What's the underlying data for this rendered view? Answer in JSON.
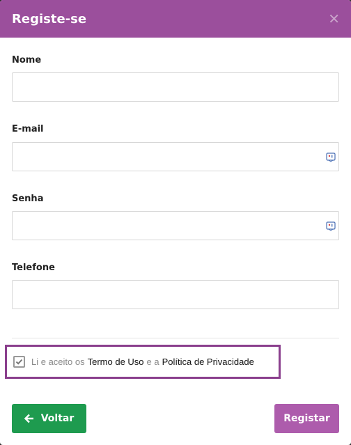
{
  "modal": {
    "title": "Registe-se",
    "close_icon": "close-icon"
  },
  "fields": {
    "name": {
      "label": "Nome",
      "value": ""
    },
    "email": {
      "label": "E-mail",
      "value": "",
      "icon": "keyboard-icon"
    },
    "password": {
      "label": "Senha",
      "value": "",
      "icon": "keyboard-icon"
    },
    "phone": {
      "label": "Telefone",
      "value": ""
    }
  },
  "terms": {
    "checked": true,
    "text_1": "Li e aceito os",
    "link_terms": "Termo de Uso",
    "text_2": "e a",
    "link_privacy": "Política de Privacidade"
  },
  "buttons": {
    "back_label": "Voltar",
    "back_icon": "arrow-left-icon",
    "register_label": "Registar"
  },
  "colors": {
    "header": "#9b4f9c",
    "back_button": "#1e9b4f",
    "register_button": "#ad5cac",
    "highlight_border": "#8a3f8d"
  }
}
